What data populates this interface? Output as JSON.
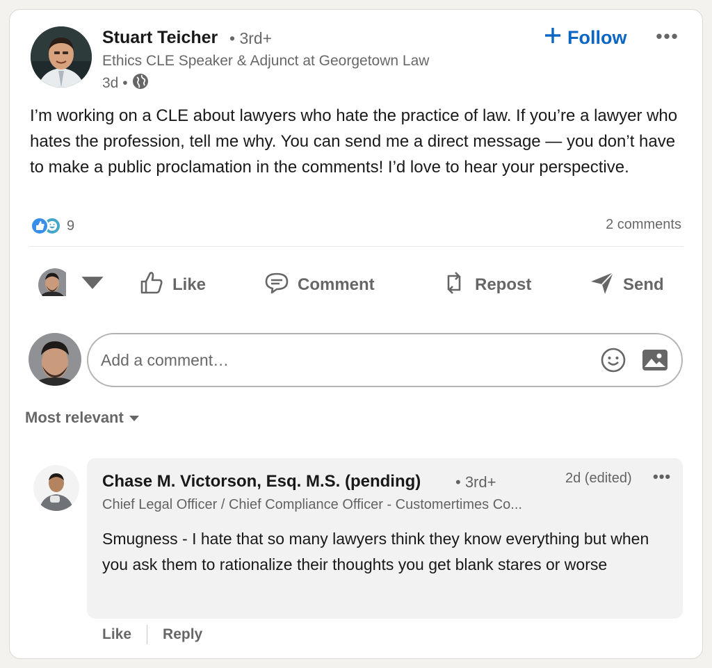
{
  "post": {
    "author": {
      "name": "Stuart Teicher",
      "degree": "• 3rd+",
      "headline": "Ethics CLE Speaker & Adjunct at Georgetown Law",
      "time": "3d •"
    },
    "follow_label": "Follow",
    "body": "I’m working on a CLE about lawyers who hate the practice of law. If you’re a lawyer who hates the profession, tell me why. You can send me a direct message — you don’t have to make a public proclamation in the comments! I’d love to hear your perspective.",
    "reaction_count": "9",
    "comments_count": "2 comments"
  },
  "actions": {
    "like": "Like",
    "comment": "Comment",
    "repost": "Repost",
    "send": "Send"
  },
  "composer": {
    "placeholder": "Add a comment…"
  },
  "sort": {
    "label": "Most relevant"
  },
  "comments": [
    {
      "name": "Chase M. Victorson, Esq. M.S. (pending)",
      "degree": "• 3rd+",
      "time": "2d (edited)",
      "headline": "Chief Legal Officer / Chief Compliance Officer - Customertimes Co...",
      "text": "Smugness - I hate that so many lawyers think they know everything but when you ask them to rationalize their thoughts you get blank stares or worse",
      "like_label": "Like",
      "reply_label": "Reply"
    }
  ],
  "colors": {
    "accent": "#0a66c2",
    "like_reaction": "#378fe9",
    "funny_reaction": "#44a6c9"
  }
}
